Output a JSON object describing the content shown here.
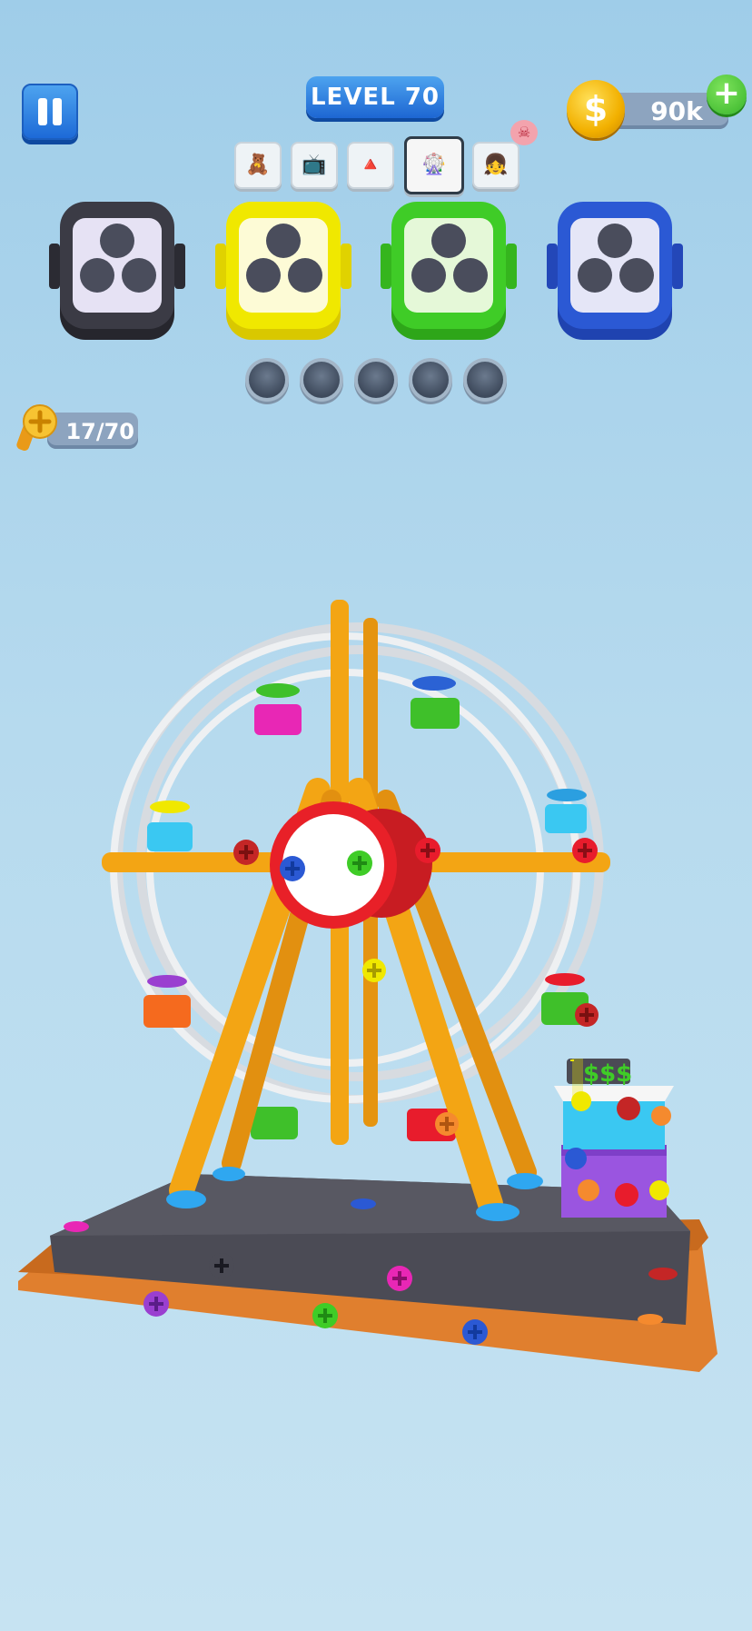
{
  "header": {
    "level_label": "LEVEL 70",
    "coins": "90k",
    "coin_symbol": "$",
    "add_symbol": "+"
  },
  "stages": [
    {
      "name": "teddy-bear",
      "icon": "🧸"
    },
    {
      "name": "tv",
      "icon": "📺"
    },
    {
      "name": "pyramid",
      "icon": "🔺"
    },
    {
      "name": "ferris-wheel",
      "icon": "🎡",
      "active": true
    },
    {
      "name": "doll",
      "icon": "👧",
      "boss": true
    }
  ],
  "boss_icon": "☠",
  "boxes": [
    {
      "color": "#3b3b45",
      "inner": "#e6e2f4"
    },
    {
      "color": "#f0e800",
      "inner": "#fdfbd6"
    },
    {
      "color": "#3fcc27",
      "inner": "#e5f8d8"
    },
    {
      "color": "#2b59d4",
      "inner": "#e5e6f7"
    }
  ],
  "empty_slots": 5,
  "screw_counter": "17/70",
  "booth_sign": "$$$"
}
